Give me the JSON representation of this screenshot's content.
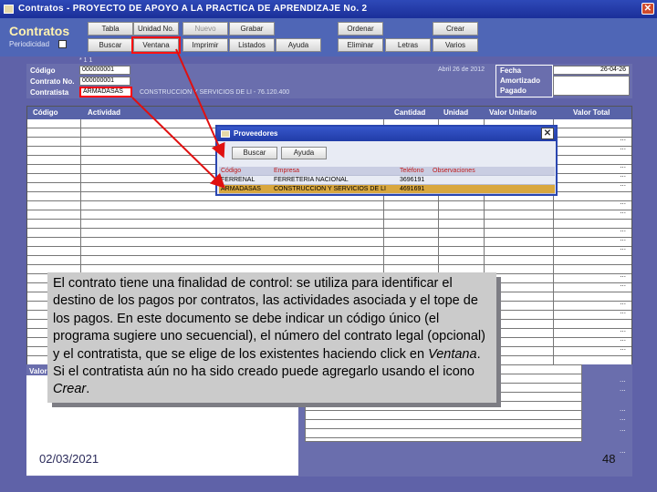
{
  "window": {
    "title": "Contratos - PROYECTO DE APOYO A LA PRACTICA DE APRENDIZAJE No. 2",
    "close_glyph": "✕"
  },
  "app": {
    "title": "Contratos",
    "periodic_label": "Periodicidad"
  },
  "toolbar": {
    "row1": [
      "Tabla",
      "Unidad No.",
      "Nuevo",
      "Grabar",
      "Ordenar",
      "Crear"
    ],
    "row2": [
      "Buscar",
      "Ventana",
      "Imprimir",
      "Listados",
      "Ayuda",
      "Eliminar",
      "Letras",
      "Varios"
    ]
  },
  "header": {
    "codigo_label": "Código",
    "codigo_value": "000000001",
    "contrato_label": "Contrato No.",
    "contrato_value": "000000001",
    "contratista_label": "Contratista",
    "contratista_value": "ARMADASAS",
    "contratista_desc": "CONSTRUCCION Y SERVICIOS DE LI - 76.120.400",
    "date_text": "Abril 26 de 2012",
    "fecha_label": "Fecha",
    "fecha_value": "26-04-26",
    "amortizado_label": "Amortizado",
    "pagado_label": "Pagado",
    "top_mark": "* 1 1"
  },
  "grid": {
    "columns": [
      "Código",
      "Actividad",
      "Cantidad",
      "Unidad",
      "Valor Unitario",
      "Valor Total"
    ],
    "row_placeholder": "..."
  },
  "dialog": {
    "title": "Proveedores",
    "close_glyph": "✕",
    "buttons": [
      "Buscar",
      "Ayuda"
    ],
    "columns": [
      "Código",
      "Empresa",
      "Teléfono",
      "Observaciones"
    ],
    "rows": [
      [
        "FERRENAL",
        "FERRETERIA NACIONAL",
        "3696191",
        ""
      ],
      [
        "ARMADASAS",
        "CONSTRUCCION Y SERVICIOS DE LI",
        "4691691",
        ""
      ]
    ]
  },
  "bottom": {
    "valor_label": "Valor",
    "objeto_label": "Objeto"
  },
  "callout": {
    "text_1": "El contrato tiene una finalidad de control: se utiliza para identificar el destino de los pagos por contratos, las actividades asociada y el tope de los pagos. En este documento se debe indicar un código único (el programa sugiere uno secuencial), el número del contrato legal (opcional) y el contratista, que se elige de los existentes haciendo click en ",
    "emph_1": "Ventana",
    "text_2": ". Si el contratista aún no ha sido creado puede agregarlo usando el icono ",
    "emph_2": "Crear",
    "text_3": "."
  },
  "footer": {
    "date": "02/03/2021",
    "page": "48"
  }
}
